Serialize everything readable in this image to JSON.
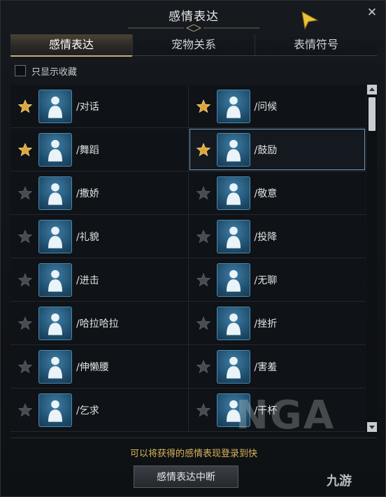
{
  "window": {
    "title": "感情表达"
  },
  "tabs": [
    {
      "label": "感情表达",
      "active": true
    },
    {
      "label": "宠物关系",
      "active": false
    },
    {
      "label": "表情符号",
      "active": false
    }
  ],
  "filter": {
    "only_favorites_label": "只显示收藏",
    "checked": false
  },
  "emotes": [
    {
      "label": "/对话",
      "favorite": true,
      "icon": "chat-gesture-icon"
    },
    {
      "label": "/问候",
      "favorite": true,
      "icon": "wave-hand-icon"
    },
    {
      "label": "/舞蹈",
      "favorite": true,
      "icon": "dance-icon"
    },
    {
      "label": "/鼓励",
      "favorite": true,
      "icon": "cheer-icon",
      "selected": true
    },
    {
      "label": "/撒娇",
      "favorite": false,
      "icon": "sparkle-pose-icon"
    },
    {
      "label": "/敬意",
      "favorite": false,
      "icon": "kneel-icon"
    },
    {
      "label": "/礼貌",
      "favorite": false,
      "icon": "bow-icon"
    },
    {
      "label": "/投降",
      "favorite": false,
      "icon": "white-flag-icon"
    },
    {
      "label": "/进击",
      "favorite": false,
      "icon": "strike-icon"
    },
    {
      "label": "/无聊",
      "favorite": false,
      "icon": "bored-icon"
    },
    {
      "label": "/哈拉哈拉",
      "favorite": false,
      "icon": "music-dance-icon"
    },
    {
      "label": "/挫折",
      "favorite": false,
      "icon": "crawl-icon"
    },
    {
      "label": "/伸懒腰",
      "favorite": false,
      "icon": "stretch-icon"
    },
    {
      "label": "/害羞",
      "favorite": false,
      "icon": "shy-icon"
    },
    {
      "label": "/乞求",
      "favorite": false,
      "icon": "beg-icon"
    },
    {
      "label": "/干杯",
      "favorite": false,
      "icon": "toast-cup-icon"
    }
  ],
  "footer": {
    "hint": "可以将获得的感情表现登录到快",
    "stop_button": "感情表达中断"
  },
  "watermarks": {
    "nga": "NGA",
    "jiuyou": "九游"
  },
  "colors": {
    "accent_gold": "#c9ab6f",
    "star_gold": "#e0a53a",
    "hint": "#d8b45a",
    "icon_blue": "#2d6a92"
  }
}
